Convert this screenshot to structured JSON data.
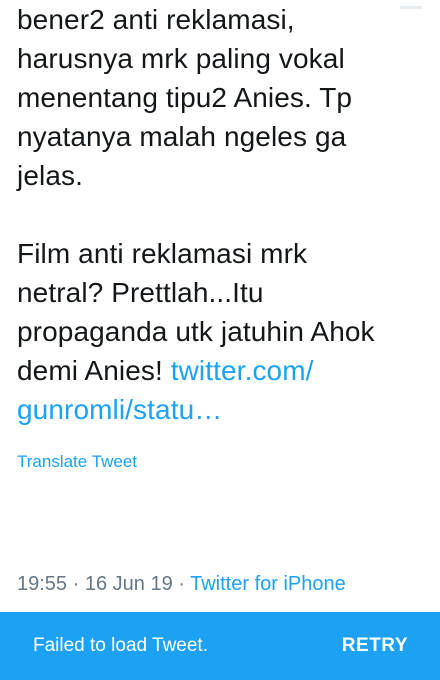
{
  "tweet": {
    "line1": "bener2 anti reklamasi,",
    "line2": "harusnya mrk paling vokal",
    "line3": "menentang tipu2 Anies. Tp",
    "line4": "nyatanya malah ngeles ga",
    "line5": "jelas.",
    "line6": "Film anti reklamasi mrk",
    "line7": "netral? Prettlah...Itu",
    "line8": "propaganda utk jatuhin Ahok",
    "line9_text": "demi Anies! ",
    "link_part1": "twitter.com/",
    "link_part2": "gunromli/statu…",
    "translate_label": "Translate Tweet"
  },
  "meta": {
    "time": "19:55",
    "separator1": " · ",
    "date": "16 Jun 19",
    "separator2": " · ",
    "source": "Twitter for iPhone"
  },
  "snackbar": {
    "message": "Failed to load Tweet.",
    "action": "RETRY"
  },
  "colors": {
    "accent": "#1da1f2",
    "text": "#14171a",
    "muted": "#657786"
  }
}
